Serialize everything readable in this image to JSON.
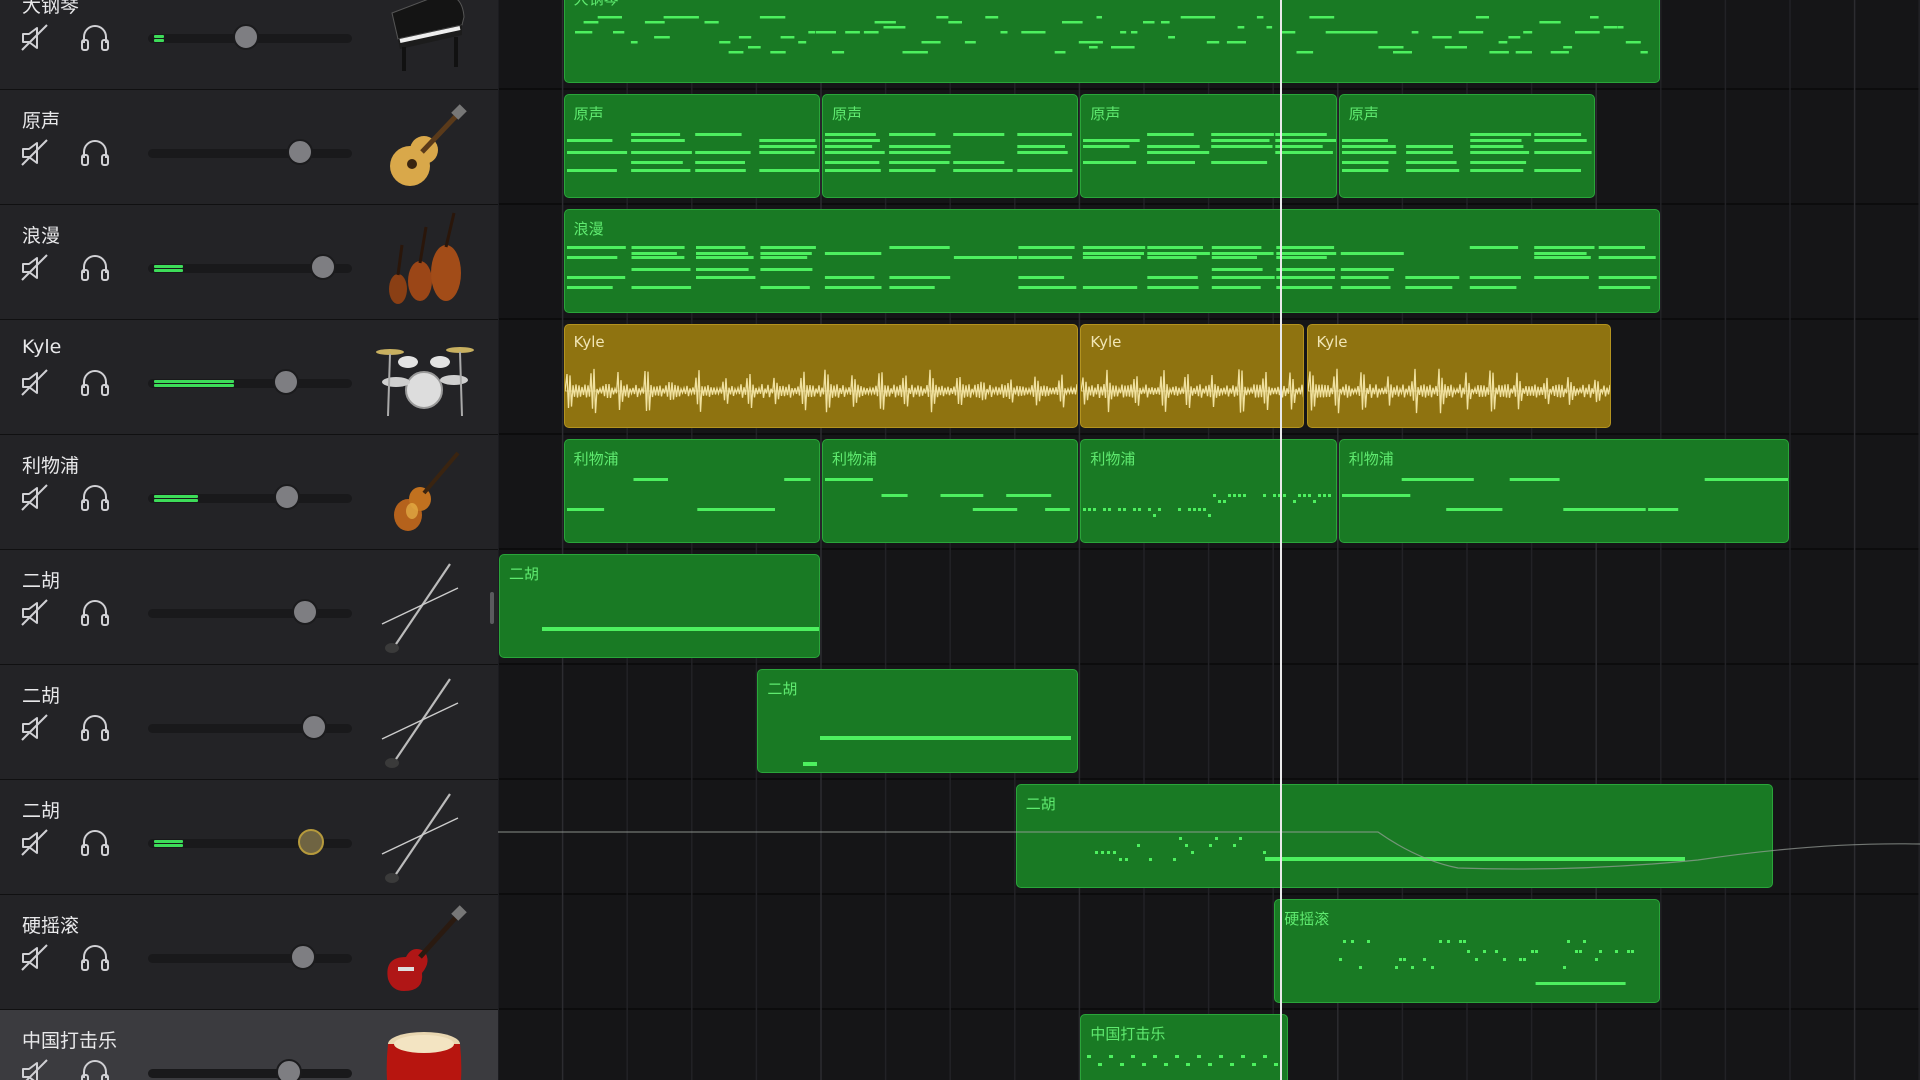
{
  "tracks": [
    {
      "name": "大钢琴",
      "icon": "grand-piano-icon",
      "volume": 0.48,
      "meter": 0.05,
      "selected": false
    },
    {
      "name": "原声",
      "icon": "acoustic-guitar-icon",
      "volume": 0.78,
      "meter": 0,
      "selected": false
    },
    {
      "name": "浪漫",
      "icon": "string-ensemble-icon",
      "volume": 0.91,
      "meter": 0.15,
      "selected": false
    },
    {
      "name": "Kyle",
      "icon": "drum-kit-icon",
      "volume": 0.7,
      "meter": 0.42,
      "selected": false
    },
    {
      "name": "利物浦",
      "icon": "violin-bass-icon",
      "volume": 0.71,
      "meter": 0.23,
      "selected": false
    },
    {
      "name": "二胡",
      "icon": "erhu-icon",
      "volume": 0.81,
      "meter": 0,
      "selected": false
    },
    {
      "name": "二胡",
      "icon": "erhu-icon",
      "volume": 0.86,
      "meter": 0,
      "selected": false
    },
    {
      "name": "二胡",
      "icon": "erhu-icon",
      "volume": 0.84,
      "meter": 0.15,
      "selected": false,
      "knob_warning": true
    },
    {
      "name": "硬摇滚",
      "icon": "electric-guitar-icon",
      "volume": 0.8,
      "meter": 0,
      "selected": false
    },
    {
      "name": "中国打击乐",
      "icon": "chinese-drum-icon",
      "volume": 0.72,
      "meter": 0,
      "selected": true
    }
  ],
  "regions": [
    {
      "track": 0,
      "start": 1,
      "end": 18,
      "label": "大钢琴",
      "type": "midi",
      "pattern": "dense"
    },
    {
      "track": 1,
      "start": 1,
      "end": 5,
      "label": "原声",
      "type": "midi",
      "pattern": "chords"
    },
    {
      "track": 1,
      "start": 5,
      "end": 9,
      "label": "原声",
      "type": "midi",
      "pattern": "chords"
    },
    {
      "track": 1,
      "start": 9,
      "end": 13,
      "label": "原声",
      "type": "midi",
      "pattern": "chords"
    },
    {
      "track": 1,
      "start": 13,
      "end": 17,
      "label": "原声",
      "type": "midi",
      "pattern": "chords"
    },
    {
      "track": 2,
      "start": 1,
      "end": 18,
      "label": "浪漫",
      "type": "midi",
      "pattern": "strings"
    },
    {
      "track": 3,
      "start": 1,
      "end": 9,
      "label": "Kyle",
      "type": "audio",
      "pattern": "drums"
    },
    {
      "track": 3,
      "start": 9,
      "end": 12.5,
      "label": "Kyle",
      "type": "audio",
      "pattern": "drums"
    },
    {
      "track": 3,
      "start": 12.5,
      "end": 17.25,
      "label": "Kyle",
      "type": "audio",
      "pattern": "drums"
    },
    {
      "track": 4,
      "start": 1,
      "end": 5,
      "label": "利物浦",
      "type": "midi",
      "pattern": "bass"
    },
    {
      "track": 4,
      "start": 5,
      "end": 9,
      "label": "利物浦",
      "type": "midi",
      "pattern": "bass"
    },
    {
      "track": 4,
      "start": 9,
      "end": 13,
      "label": "利物浦",
      "type": "midi",
      "pattern": "dotted"
    },
    {
      "track": 4,
      "start": 13,
      "end": 20,
      "label": "利物浦",
      "type": "midi",
      "pattern": "bass-long"
    },
    {
      "track": 5,
      "start": 0,
      "end": 5,
      "label": "二胡",
      "type": "midi",
      "pattern": "long-one"
    },
    {
      "track": 6,
      "start": 4,
      "end": 9,
      "label": "二胡",
      "type": "midi",
      "pattern": "long-two"
    },
    {
      "track": 7,
      "start": 8,
      "end": 19.75,
      "label": "二胡",
      "type": "midi",
      "pattern": "erhu-run"
    },
    {
      "track": 8,
      "start": 12,
      "end": 18,
      "label": "硬摇滚",
      "type": "midi",
      "pattern": "rock"
    },
    {
      "track": 9,
      "start": 9,
      "end": 12.25,
      "label": "中国打击乐",
      "type": "midi",
      "pattern": "perc"
    }
  ],
  "playhead_beat": 12.1
}
